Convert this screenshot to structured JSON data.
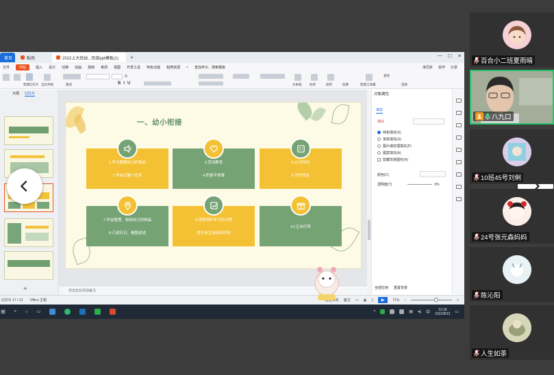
{
  "screen": {
    "tabs": [
      {
        "label": "首页",
        "color": "#1b6dd9"
      },
      {
        "label": "稻壳",
        "color": "#e8531f"
      },
      {
        "label": "2022上大班幼...衔接ppt模板(1)",
        "color": "#e8531f"
      }
    ],
    "menu": [
      "文件",
      "开始",
      "插入",
      "设计",
      "切换",
      "动画",
      "放映",
      "审阅",
      "视图",
      "开发工具",
      "特色功能",
      "稻壳资源"
    ],
    "menu_active": "开始",
    "menu_search": "查找命令、搜索模板",
    "menu_right": [
      "未同步",
      "协作",
      "分享"
    ],
    "ribbon": {
      "new_slide": "新建幻灯片",
      "layout": "版式",
      "from_current": "当页开始",
      "font_size_up": "A",
      "text_box": "文本框",
      "shape": "形状",
      "arrange": "排列",
      "outline": "轮廓",
      "smart_tools": "智能工具箱",
      "find": "查找",
      "select": "选择"
    },
    "left_panel": {
      "tab_outline": "大纲",
      "tab_slides": "幻灯片"
    },
    "slide": {
      "title": "一、幼小衔接",
      "cards": [
        {
          "lines": [
            "1.学习整理自己的物品",
            "2.学会记要小任务"
          ]
        },
        {
          "lines": [
            "3.劳动教育",
            "4.积极平常事"
          ]
        },
        {
          "lines": [
            "5.认识时间",
            "6.守时观念"
          ]
        },
        {
          "lines": [
            "7.学会整理、收纳自己的物品",
            "8.口述日记、看图讲述"
          ]
        },
        {
          "lines": [
            "9.培养倾听学习的习惯",
            "提升自主阅读的时间"
          ]
        },
        {
          "lines": [
            "10.正向引导"
          ]
        }
      ],
      "icons": [
        "speaker-icon",
        "heart-hand-icon",
        "calculator-icon",
        "location-icon",
        "chart-icon",
        "gift-icon"
      ]
    },
    "notes_placeholder": "单击此处添加备注",
    "right_panel": {
      "title": "对象属性",
      "tab": "填充",
      "fill_label": "填充",
      "options": [
        "纯色填充(S)",
        "渐变填充(G)",
        "图片或纹理填充(P)",
        "图案填充(A)",
        "隐藏背景图形(H)"
      ],
      "transparency_label": "颜色(C)",
      "slider_label": "透明度(T)",
      "slider_value": "0%",
      "bottom": [
        "全部应用",
        "重置背景"
      ]
    },
    "status": {
      "slide_count": "幻灯片 17 / 21",
      "theme": "Office 主题",
      "smart_beautify": "智能美化",
      "notes": "备注",
      "zoom": "71%"
    },
    "taskbar": {
      "time": "13:18",
      "date": "2022/8/23"
    }
  },
  "participants": [
    {
      "name": "百合小二班夏雨晴",
      "avatar_color": "#f5d1d7",
      "muted": true
    },
    {
      "name": "八九口",
      "avatar_color": "#7a8a6e",
      "muted": false,
      "active": true,
      "host": true
    },
    {
      "name": "10班45号刘俐",
      "avatar_color": "#c9b9df",
      "muted": true
    },
    {
      "name": "24号张元森妈妈",
      "avatar_color": "#f2e0d8",
      "muted": true
    },
    {
      "name": "陈沁阳",
      "avatar_color": "#dcecf0",
      "muted": true
    },
    {
      "name": "人生如茶",
      "avatar_color": "#c8c9a8",
      "muted": true
    }
  ]
}
